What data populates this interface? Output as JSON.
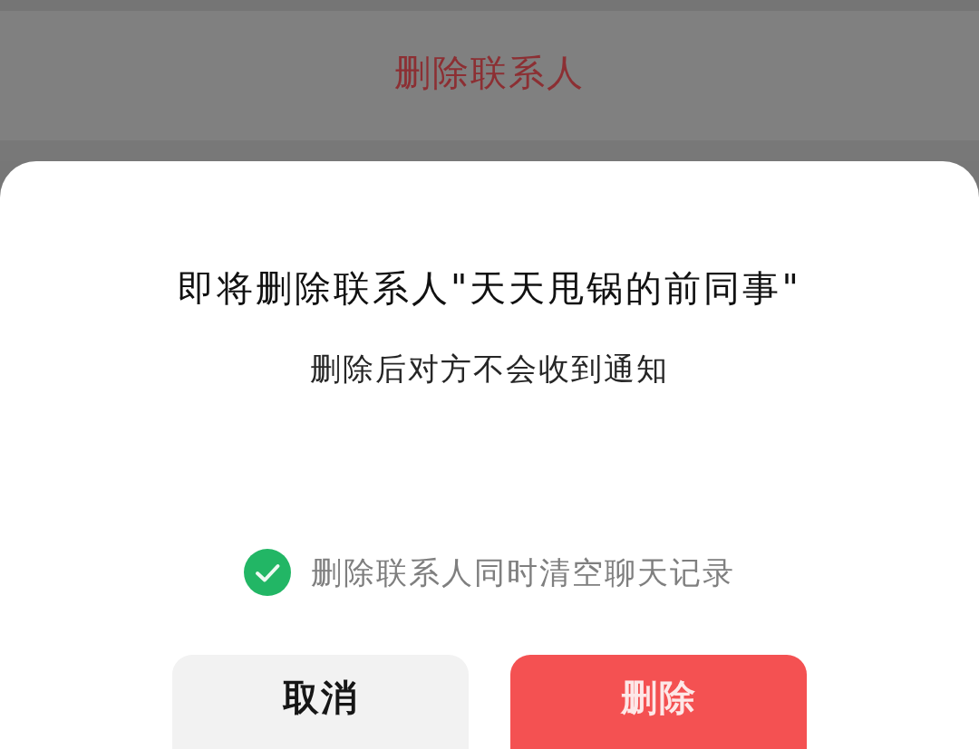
{
  "background": {
    "menu_item": "删除联系人"
  },
  "dialog": {
    "title": "即将删除联系人\"天天甩锅的前同事\"",
    "message": "删除后对方不会收到通知",
    "option": {
      "label": "删除联系人同时清空聊天记录",
      "checked": true
    },
    "buttons": [
      {
        "label": "取消",
        "kind": "secondary"
      },
      {
        "label": "删除",
        "kind": "danger"
      }
    ]
  }
}
